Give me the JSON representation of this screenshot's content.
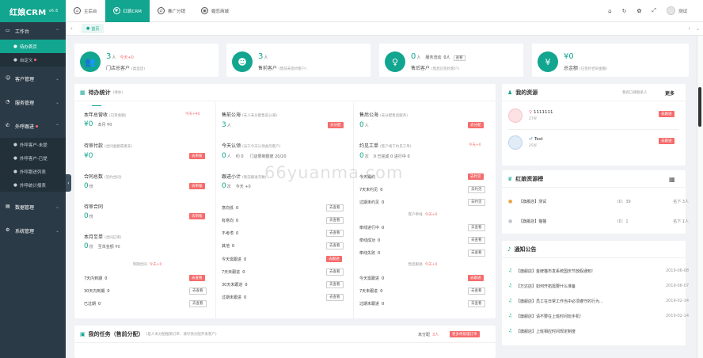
{
  "app": {
    "logo": "红娘CRM",
    "version": "v6.6"
  },
  "sidebar": {
    "sections": [
      {
        "label": "工作台",
        "items": [
          {
            "label": "待办首页"
          },
          {
            "label": "自定义"
          }
        ]
      },
      {
        "label": "客户管理"
      },
      {
        "label": "服务管理"
      },
      {
        "label": "外呼跟进",
        "items": [
          {
            "label": "外呼客户-未提"
          },
          {
            "label": "外呼客户-已提"
          },
          {
            "label": "外呼跟进列表"
          },
          {
            "label": "外呼统计报表"
          }
        ]
      },
      {
        "label": "数据管理"
      },
      {
        "label": "系统管理"
      }
    ]
  },
  "topbar": {
    "tabs": [
      "主后台",
      "红娘CRM",
      "推广分销",
      "婚恋商城"
    ],
    "user": "测试"
  },
  "breadcrumb": {
    "home": "首页"
  },
  "stats": [
    {
      "num": "3",
      "unit": "人",
      "today": "今天+0",
      "label": "门店总客户",
      "note": "(类型店)"
    },
    {
      "num": "3",
      "unit": "人",
      "label": "售前客户",
      "note": "(售前未签约客户)"
    },
    {
      "num": "0",
      "unit": "人",
      "extra_label": "服务流动",
      "extra_num": "0人",
      "extra_btn": "查看",
      "label": "售后客户",
      "note": "(售后已签约客户)"
    },
    {
      "num": "¥0",
      "label": "总金额",
      "note": "(已签约合同金额)"
    }
  ],
  "todo": {
    "title": "待办统计",
    "note": "(待办)",
    "col1": {
      "b1": {
        "title": "本年总营收",
        "note": "(已审金额)",
        "today": "今天+¥0",
        "num": "¥0",
        "sub": "本月 ¥0"
      },
      "b2": {
        "title": "待审付款",
        "note": "(合同金额或者未)",
        "num": "¥0",
        "btn": "去审核"
      },
      "b3": {
        "title": "合同总数",
        "note": "(签约合同)",
        "num": "0",
        "unit": "份",
        "btn": "去审核"
      },
      "b4": {
        "title": "待审合同",
        "num": "0",
        "unit": "份",
        "btn": "去审核"
      },
      "b5": {
        "title": "本月至单",
        "note": "(合同已审)",
        "num": "0",
        "unit": "份",
        "sub": "至单金额 ¥0"
      },
      "sep": {
        "label": "到期合同",
        "today": "今天+0"
      },
      "rows": [
        {
          "label": "7天内到期",
          "val": "0",
          "btn": "去查看"
        },
        {
          "label": "30天内到期",
          "val": "0",
          "btn": "去查看"
        },
        {
          "label": "已过期",
          "val": "0",
          "btn": "去查看"
        }
      ]
    },
    "col2": {
      "b1": {
        "title": "售前公海",
        "note": "(未人未分配售前公海)",
        "num": "3",
        "unit": "人",
        "btn": "去分配"
      },
      "b2": {
        "title": "今天认领",
        "note": "(员工今天认领此的客户)",
        "num": "0",
        "unit": "人",
        "sub1": "约 0",
        "sub2": "门店限制额度 20/20"
      },
      "b3": {
        "title": "跟进小计",
        "note": "(售前跟进次数)",
        "num": "0",
        "unit": "次",
        "sub": "今天 +0"
      },
      "rows": [
        {
          "label": "意向低",
          "val": "0",
          "btn": "去查看"
        },
        {
          "label": "有意向",
          "val": "0",
          "btn": "去查看"
        },
        {
          "label": "不考虑",
          "val": "0",
          "btn": "去查看"
        },
        {
          "label": "其他",
          "val": "0",
          "btn": "去查看"
        },
        {
          "label": "今天需跟进",
          "val": "0",
          "btn": "去跟进"
        },
        {
          "label": "7天未跟进",
          "val": "0",
          "btn": "去查看"
        },
        {
          "label": "30天未跟进",
          "val": "0",
          "btn": "去查看"
        },
        {
          "label": "过期未跟进",
          "val": "0",
          "btn": "去查看"
        }
      ]
    },
    "col3": {
      "b1": {
        "title": "售后公海",
        "note": "(未分配售后服务)",
        "num": "0",
        "unit": "人",
        "btn": "去分配"
      },
      "b2": {
        "title": "约见工单",
        "note": "(客户线下约见工单)",
        "today": "今天+0",
        "num": "0",
        "unit": "次",
        "sub": "0 已完成 0 进行中 0"
      },
      "rows_a": [
        {
          "label": "今天需约",
          "val": "",
          "btn": "去约见"
        },
        {
          "label": "7天未约见",
          "val": "0",
          "btn": "去约见"
        },
        {
          "label": "过期未约见",
          "val": "0",
          "btn": "去约见"
        }
      ],
      "sep_a": {
        "label": "客户牵线",
        "today": "今天+0"
      },
      "rows_b": [
        {
          "label": "牵线进行中",
          "val": "0",
          "btn": "去查看"
        },
        {
          "label": "牵线成功",
          "val": "0",
          "btn": "去查看"
        },
        {
          "label": "牵线失败",
          "val": "0",
          "btn": "去查看"
        }
      ],
      "sep_b": {
        "label": "售后跟进",
        "today": "今天+0"
      },
      "rows_c": [
        {
          "label": "今天需跟进",
          "val": "0",
          "btn": "去跟进"
        },
        {
          "label": "7天未跟进",
          "val": "0",
          "btn": "去查看"
        },
        {
          "label": "过期未跟进",
          "val": "0",
          "btn": "去查看"
        }
      ]
    }
  },
  "task": {
    "title": "我的任务（售前分配）",
    "note": "(是人未分配推销订单、请尽快分配开发客户)",
    "count_label": "未分配",
    "count": "3人",
    "btn": "更多待处理订单"
  },
  "resource": {
    "title": "我的资源",
    "right_note": "我有口碑联系人",
    "more": "更多",
    "items": [
      {
        "name": "1111111",
        "age": "27岁",
        "btn": "去跟进"
      },
      {
        "name": "Test",
        "age": "25岁",
        "btn": "去跟进"
      }
    ]
  },
  "ranking": {
    "title": "红娘资源榜",
    "rows": [
      {
        "name": "【旗舰店】测试",
        "id": "ID：39",
        "num": "名下 3人"
      },
      {
        "name": "【旗舰店】猫猫",
        "id": "ID：1",
        "num": "名下 1人"
      }
    ]
  },
  "notice": {
    "title": "通知公告",
    "rows": [
      {
        "text": "【旗舰店】金牌猫市发系统国庆节放假通知!",
        "date": "2019-06-08"
      },
      {
        "text": "【万达店】如何开拓需要什么准备",
        "date": "2019-06-07"
      },
      {
        "text": "【旗舰店】员工在日常工作当中必须遵守的行为...",
        "date": "2019-02-14"
      },
      {
        "text": "【旗舰店】请不要在上班时间玩手机!",
        "date": "2019-02-14"
      },
      {
        "text": "【旗舰店】上班相应时间规定制度",
        "date": ""
      }
    ]
  },
  "watermark": "66yuanma.com",
  "colors": {
    "brand": "#12a58f",
    "sidebar": "#2b3a47",
    "danger": "#f56c6c"
  }
}
